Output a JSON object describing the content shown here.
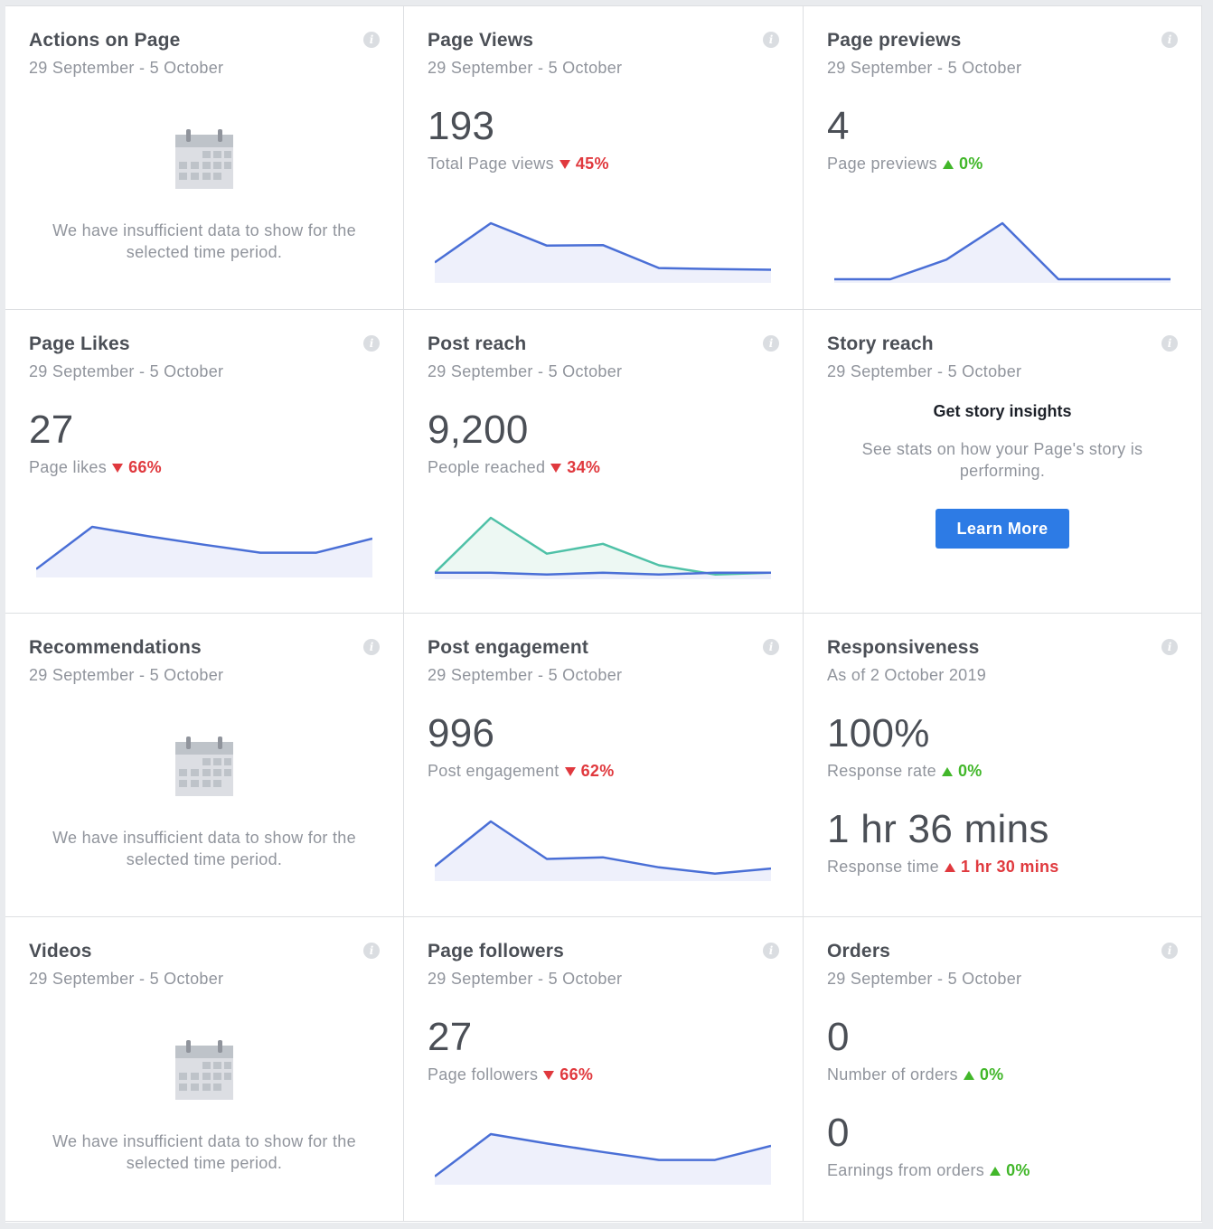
{
  "cards": {
    "actions": {
      "title": "Actions on Page",
      "date": "29 September - 5 October",
      "empty_message": "We have insufficient data to show for the selected time period."
    },
    "page_views": {
      "title": "Page Views",
      "date": "29 September - 5 October",
      "value": "193",
      "metric_label": "Total Page views",
      "delta": "45%",
      "delta_direction": "down"
    },
    "page_previews": {
      "title": "Page previews",
      "date": "29 September - 5 October",
      "value": "4",
      "metric_label": "Page previews",
      "delta": "0%",
      "delta_direction": "up"
    },
    "page_likes": {
      "title": "Page Likes",
      "date": "29 September - 5 October",
      "value": "27",
      "metric_label": "Page likes",
      "delta": "66%",
      "delta_direction": "down"
    },
    "post_reach": {
      "title": "Post reach",
      "date": "29 September - 5 October",
      "value": "9,200",
      "metric_label": "People reached",
      "delta": "34%",
      "delta_direction": "down"
    },
    "story_reach": {
      "title": "Story reach",
      "date": "29 September - 5 October",
      "heading": "Get story insights",
      "text": "See stats on how your Page's story is performing.",
      "button_label": "Learn More"
    },
    "recommendations": {
      "title": "Recommendations",
      "date": "29 September - 5 October",
      "empty_message": "We have insufficient data to show for the selected time period."
    },
    "post_engagement": {
      "title": "Post engagement",
      "date": "29 September - 5 October",
      "value": "996",
      "metric_label": "Post engagement",
      "delta": "62%",
      "delta_direction": "down"
    },
    "responsiveness": {
      "title": "Responsiveness",
      "date": "As of 2 October 2019",
      "value": "100%",
      "metric_label": "Response rate",
      "delta": "0%",
      "delta_direction": "up",
      "value2": "1 hr 36 mins",
      "metric_label2": "Response time",
      "delta2": "1 hr 30 mins",
      "delta2_direction": "up"
    },
    "videos": {
      "title": "Videos",
      "date": "29 September - 5 October",
      "empty_message": "We have insufficient data to show for the selected time period."
    },
    "page_followers": {
      "title": "Page followers",
      "date": "29 September - 5 October",
      "value": "27",
      "metric_label": "Page followers",
      "delta": "66%",
      "delta_direction": "down"
    },
    "orders": {
      "title": "Orders",
      "date": "29 September - 5 October",
      "value": "0",
      "metric_label": "Number of orders",
      "delta": "0%",
      "delta_direction": "up",
      "value2": "0",
      "metric_label2": "Earnings from orders",
      "delta2": "0%",
      "delta2_direction": "up"
    }
  },
  "colors": {
    "line": "#4a6fd6",
    "fill": "#eef0fb",
    "line_secondary": "#4fc1a7",
    "fill_secondary": "#edf8f3",
    "down": "#e0393e",
    "up": "#42b72a",
    "button": "#2d7be5"
  },
  "sparklines": {
    "page_views": [
      [
        0.3,
        1.0,
        0.6,
        0.61,
        0.2,
        0.18,
        0.17
      ]
    ],
    "page_previews": [
      [
        0,
        0,
        0.35,
        1.0,
        0,
        0,
        0
      ]
    ],
    "page_likes": [
      [
        0.1,
        1.0,
        0.8,
        0.62,
        0.45,
        0.45,
        0.75
      ]
    ],
    "post_reach": [
      [
        0.05,
        0.05,
        0.02,
        0.05,
        0.02,
        0.05,
        0.05
      ],
      [
        0.05,
        1.0,
        0.38,
        0.55,
        0.18,
        0.02,
        0.05
      ]
    ],
    "post_engagement": [
      [
        0.2,
        1.0,
        0.33,
        0.36,
        0.18,
        0.07,
        0.16
      ]
    ],
    "page_followers": [
      [
        0.1,
        1.0,
        0.8,
        0.62,
        0.45,
        0.45,
        0.75
      ]
    ]
  }
}
